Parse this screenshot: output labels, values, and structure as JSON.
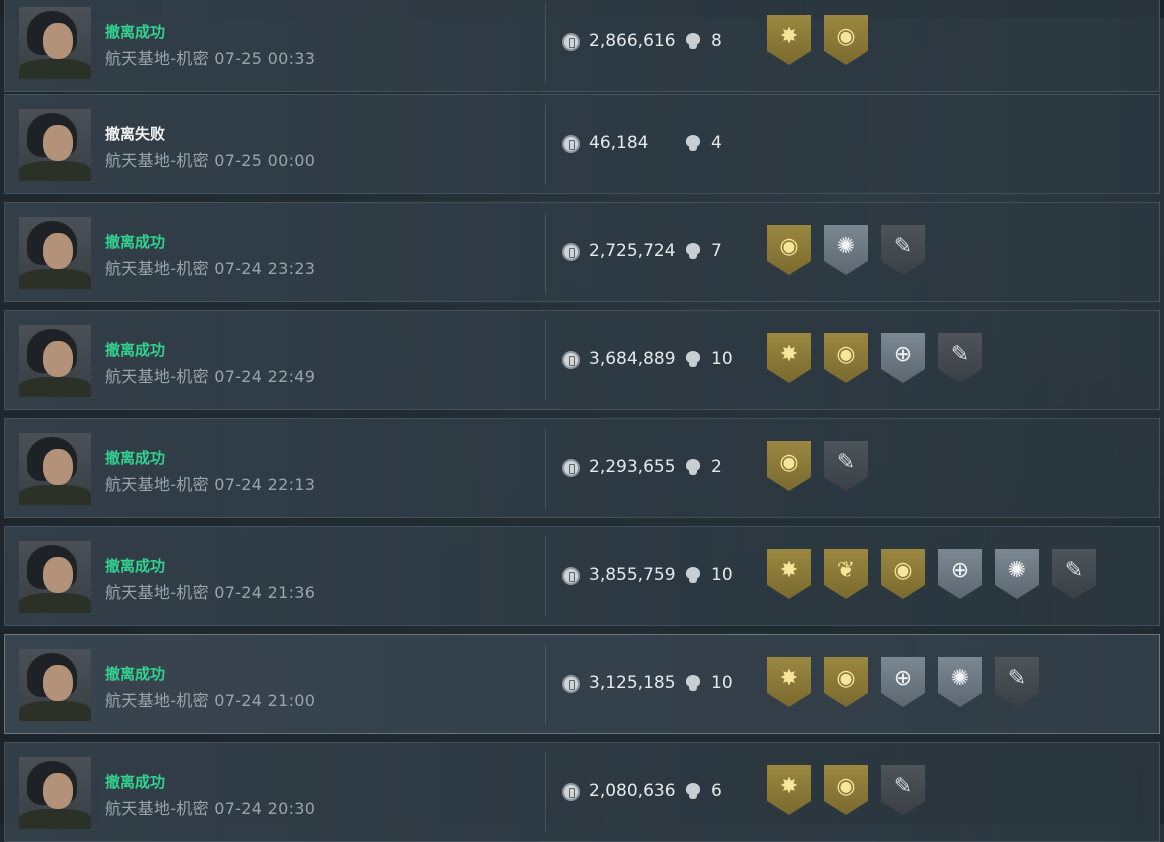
{
  "records": [
    {
      "status": "撤离成功",
      "outcome": "success",
      "map": "航天基地-机密",
      "datetime": "07-25 00:33",
      "money": "2,866,616",
      "kills": "8",
      "badges": [
        {
          "tier": "gold",
          "icon": "sunburst-icon",
          "glyph": "✸"
        },
        {
          "tier": "gold",
          "icon": "emblem-icon",
          "glyph": "◉"
        }
      ]
    },
    {
      "status": "撤离失败",
      "outcome": "fail",
      "map": "航天基地-机密",
      "datetime": "07-25 00:00",
      "money": "46,184",
      "kills": "4",
      "badges": []
    },
    {
      "status": "撤离成功",
      "outcome": "success",
      "map": "航天基地-机密",
      "datetime": "07-24 23:23",
      "money": "2,725,724",
      "kills": "7",
      "badges": [
        {
          "tier": "gold",
          "icon": "emblem-icon",
          "glyph": "◉"
        },
        {
          "tier": "silver",
          "icon": "explosion-icon",
          "glyph": "✺"
        },
        {
          "tier": "dark",
          "icon": "rifle-icon",
          "glyph": "✎"
        }
      ]
    },
    {
      "status": "撤离成功",
      "outcome": "success",
      "map": "航天基地-机密",
      "datetime": "07-24 22:49",
      "money": "3,684,889",
      "kills": "10",
      "badges": [
        {
          "tier": "gold",
          "icon": "sunburst-icon",
          "glyph": "✸"
        },
        {
          "tier": "gold",
          "icon": "emblem-icon",
          "glyph": "◉"
        },
        {
          "tier": "silver",
          "icon": "crosshair-icon",
          "glyph": "⊕"
        },
        {
          "tier": "dark",
          "icon": "rifle-icon",
          "glyph": "✎"
        }
      ]
    },
    {
      "status": "撤离成功",
      "outcome": "success",
      "map": "航天基地-机密",
      "datetime": "07-24 22:13",
      "money": "2,293,655",
      "kills": "2",
      "badges": [
        {
          "tier": "gold",
          "icon": "emblem-icon",
          "glyph": "◉"
        },
        {
          "tier": "dark",
          "icon": "rifle-icon",
          "glyph": "✎"
        }
      ]
    },
    {
      "status": "撤离成功",
      "outcome": "success",
      "map": "航天基地-机密",
      "datetime": "07-24 21:36",
      "money": "3,855,759",
      "kills": "10",
      "badges": [
        {
          "tier": "gold",
          "icon": "sunburst-icon",
          "glyph": "✸"
        },
        {
          "tier": "gold",
          "icon": "wreath-icon",
          "glyph": "❦"
        },
        {
          "tier": "gold",
          "icon": "emblem-icon",
          "glyph": "◉"
        },
        {
          "tier": "silver",
          "icon": "crosshair-icon",
          "glyph": "⊕"
        },
        {
          "tier": "silver",
          "icon": "explosion-icon",
          "glyph": "✺"
        },
        {
          "tier": "dark",
          "icon": "rifle-icon",
          "glyph": "✎"
        }
      ]
    },
    {
      "status": "撤离成功",
      "outcome": "success",
      "map": "航天基地-机密",
      "datetime": "07-24 21:00",
      "money": "3,125,185",
      "kills": "10",
      "badges": [
        {
          "tier": "gold",
          "icon": "sunburst-icon",
          "glyph": "✸"
        },
        {
          "tier": "gold",
          "icon": "emblem-icon",
          "glyph": "◉"
        },
        {
          "tier": "silver",
          "icon": "crosshair-icon",
          "glyph": "⊕"
        },
        {
          "tier": "silver",
          "icon": "explosion-icon",
          "glyph": "✺"
        },
        {
          "tier": "dark",
          "icon": "rifle-icon",
          "glyph": "✎"
        }
      ]
    },
    {
      "status": "撤离成功",
      "outcome": "success",
      "map": "航天基地-机密",
      "datetime": "07-24 20:30",
      "money": "2,080,636",
      "kills": "6",
      "badges": [
        {
          "tier": "gold",
          "icon": "sunburst-icon",
          "glyph": "✸"
        },
        {
          "tier": "gold",
          "icon": "emblem-icon",
          "glyph": "◉"
        },
        {
          "tier": "dark",
          "icon": "rifle-icon",
          "glyph": "✎"
        }
      ]
    }
  ],
  "colors": {
    "success": "#33d18f",
    "fail": "#f2f2f2",
    "gold": "#9a8740",
    "silver": "#7b8892",
    "dark": "#4d545a"
  }
}
